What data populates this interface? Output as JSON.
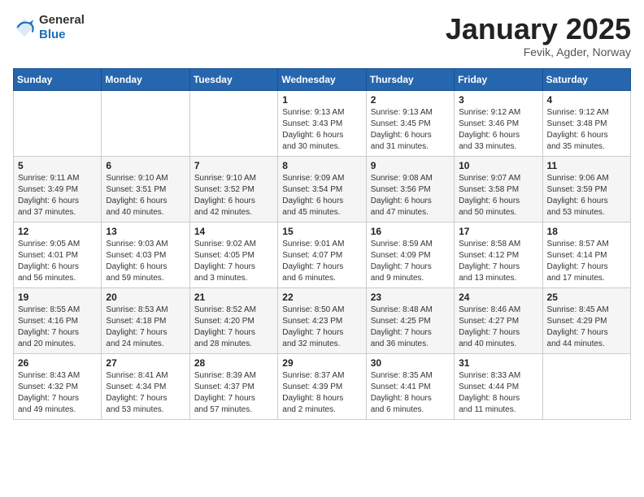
{
  "header": {
    "logo_general": "General",
    "logo_blue": "Blue",
    "month": "January 2025",
    "location": "Fevik, Agder, Norway"
  },
  "weekdays": [
    "Sunday",
    "Monday",
    "Tuesday",
    "Wednesday",
    "Thursday",
    "Friday",
    "Saturday"
  ],
  "weeks": [
    [
      {
        "day": "",
        "info": ""
      },
      {
        "day": "",
        "info": ""
      },
      {
        "day": "",
        "info": ""
      },
      {
        "day": "1",
        "info": "Sunrise: 9:13 AM\nSunset: 3:43 PM\nDaylight: 6 hours\nand 30 minutes."
      },
      {
        "day": "2",
        "info": "Sunrise: 9:13 AM\nSunset: 3:45 PM\nDaylight: 6 hours\nand 31 minutes."
      },
      {
        "day": "3",
        "info": "Sunrise: 9:12 AM\nSunset: 3:46 PM\nDaylight: 6 hours\nand 33 minutes."
      },
      {
        "day": "4",
        "info": "Sunrise: 9:12 AM\nSunset: 3:48 PM\nDaylight: 6 hours\nand 35 minutes."
      }
    ],
    [
      {
        "day": "5",
        "info": "Sunrise: 9:11 AM\nSunset: 3:49 PM\nDaylight: 6 hours\nand 37 minutes."
      },
      {
        "day": "6",
        "info": "Sunrise: 9:10 AM\nSunset: 3:51 PM\nDaylight: 6 hours\nand 40 minutes."
      },
      {
        "day": "7",
        "info": "Sunrise: 9:10 AM\nSunset: 3:52 PM\nDaylight: 6 hours\nand 42 minutes."
      },
      {
        "day": "8",
        "info": "Sunrise: 9:09 AM\nSunset: 3:54 PM\nDaylight: 6 hours\nand 45 minutes."
      },
      {
        "day": "9",
        "info": "Sunrise: 9:08 AM\nSunset: 3:56 PM\nDaylight: 6 hours\nand 47 minutes."
      },
      {
        "day": "10",
        "info": "Sunrise: 9:07 AM\nSunset: 3:58 PM\nDaylight: 6 hours\nand 50 minutes."
      },
      {
        "day": "11",
        "info": "Sunrise: 9:06 AM\nSunset: 3:59 PM\nDaylight: 6 hours\nand 53 minutes."
      }
    ],
    [
      {
        "day": "12",
        "info": "Sunrise: 9:05 AM\nSunset: 4:01 PM\nDaylight: 6 hours\nand 56 minutes."
      },
      {
        "day": "13",
        "info": "Sunrise: 9:03 AM\nSunset: 4:03 PM\nDaylight: 6 hours\nand 59 minutes."
      },
      {
        "day": "14",
        "info": "Sunrise: 9:02 AM\nSunset: 4:05 PM\nDaylight: 7 hours\nand 3 minutes."
      },
      {
        "day": "15",
        "info": "Sunrise: 9:01 AM\nSunset: 4:07 PM\nDaylight: 7 hours\nand 6 minutes."
      },
      {
        "day": "16",
        "info": "Sunrise: 8:59 AM\nSunset: 4:09 PM\nDaylight: 7 hours\nand 9 minutes."
      },
      {
        "day": "17",
        "info": "Sunrise: 8:58 AM\nSunset: 4:12 PM\nDaylight: 7 hours\nand 13 minutes."
      },
      {
        "day": "18",
        "info": "Sunrise: 8:57 AM\nSunset: 4:14 PM\nDaylight: 7 hours\nand 17 minutes."
      }
    ],
    [
      {
        "day": "19",
        "info": "Sunrise: 8:55 AM\nSunset: 4:16 PM\nDaylight: 7 hours\nand 20 minutes."
      },
      {
        "day": "20",
        "info": "Sunrise: 8:53 AM\nSunset: 4:18 PM\nDaylight: 7 hours\nand 24 minutes."
      },
      {
        "day": "21",
        "info": "Sunrise: 8:52 AM\nSunset: 4:20 PM\nDaylight: 7 hours\nand 28 minutes."
      },
      {
        "day": "22",
        "info": "Sunrise: 8:50 AM\nSunset: 4:23 PM\nDaylight: 7 hours\nand 32 minutes."
      },
      {
        "day": "23",
        "info": "Sunrise: 8:48 AM\nSunset: 4:25 PM\nDaylight: 7 hours\nand 36 minutes."
      },
      {
        "day": "24",
        "info": "Sunrise: 8:46 AM\nSunset: 4:27 PM\nDaylight: 7 hours\nand 40 minutes."
      },
      {
        "day": "25",
        "info": "Sunrise: 8:45 AM\nSunset: 4:29 PM\nDaylight: 7 hours\nand 44 minutes."
      }
    ],
    [
      {
        "day": "26",
        "info": "Sunrise: 8:43 AM\nSunset: 4:32 PM\nDaylight: 7 hours\nand 49 minutes."
      },
      {
        "day": "27",
        "info": "Sunrise: 8:41 AM\nSunset: 4:34 PM\nDaylight: 7 hours\nand 53 minutes."
      },
      {
        "day": "28",
        "info": "Sunrise: 8:39 AM\nSunset: 4:37 PM\nDaylight: 7 hours\nand 57 minutes."
      },
      {
        "day": "29",
        "info": "Sunrise: 8:37 AM\nSunset: 4:39 PM\nDaylight: 8 hours\nand 2 minutes."
      },
      {
        "day": "30",
        "info": "Sunrise: 8:35 AM\nSunset: 4:41 PM\nDaylight: 8 hours\nand 6 minutes."
      },
      {
        "day": "31",
        "info": "Sunrise: 8:33 AM\nSunset: 4:44 PM\nDaylight: 8 hours\nand 11 minutes."
      },
      {
        "day": "",
        "info": ""
      }
    ]
  ]
}
